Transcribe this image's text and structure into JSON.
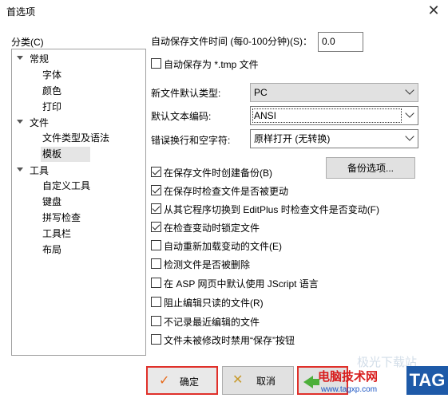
{
  "window": {
    "title": "首选项"
  },
  "sidebar": {
    "label": "分类(C)",
    "items": [
      {
        "label": "常规",
        "level": 0,
        "expanded": true
      },
      {
        "label": "字体",
        "level": 1
      },
      {
        "label": "颜色",
        "level": 1
      },
      {
        "label": "打印",
        "level": 1
      },
      {
        "label": "文件",
        "level": 0,
        "expanded": true
      },
      {
        "label": "文件类型及语法",
        "level": 1
      },
      {
        "label": "模板",
        "level": 1,
        "selected": true
      },
      {
        "label": "工具",
        "level": 0,
        "expanded": true
      },
      {
        "label": "自定义工具",
        "level": 1
      },
      {
        "label": "键盘",
        "level": 1
      },
      {
        "label": "拼写检查",
        "level": 1
      },
      {
        "label": "工具栏",
        "level": 1
      },
      {
        "label": "布局",
        "level": 1
      }
    ]
  },
  "form": {
    "autosave_label": "自动保存文件时间 (每0-100分钟)(S)：",
    "autosave_value": "0.0",
    "autosave_tmp_label": "自动保存为 *.tmp 文件",
    "new_file_type_label": "新文件默认类型:",
    "new_file_type_value": "PC",
    "encoding_label": "默认文本编码:",
    "encoding_value": "ANSI",
    "newline_label": "错误换行和空字符:",
    "newline_value": "原样打开 (无转换)",
    "backup_button": "备份选项..."
  },
  "options": [
    {
      "label": "在保存文件时创建备份(B)",
      "checked": true
    },
    {
      "label": "在保存时检查文件是否被更动",
      "checked": true
    },
    {
      "label": "从其它程序切换到 EditPlus 时检查文件是否变动(F)",
      "checked": true
    },
    {
      "label": "在检查变动时锁定文件",
      "checked": true
    },
    {
      "label": "自动重新加载变动的文件(E)",
      "checked": false
    },
    {
      "label": "检测文件是否被删除",
      "checked": false
    },
    {
      "label": "在 ASP 网页中默认使用 JScript 语言",
      "checked": false
    },
    {
      "label": "阻止编辑只读的文件(R)",
      "checked": false
    },
    {
      "label": "不记录最近编辑的文件",
      "checked": false
    },
    {
      "label": "文件未被修改时禁用“保存”按钮",
      "checked": false
    }
  ],
  "footer": {
    "ok_label": "确定",
    "cancel_label": "取消"
  },
  "watermark": {
    "title": "电脑技术网",
    "url": "www.tagxp.com",
    "tag": "TAG",
    "faint": "极光下载站"
  },
  "colors": {
    "highlight_border": "#e0302a",
    "check_icon": "#e76a1b",
    "apply_arrow": "#4caf3a",
    "watermark_blue": "#1e5aa8"
  }
}
